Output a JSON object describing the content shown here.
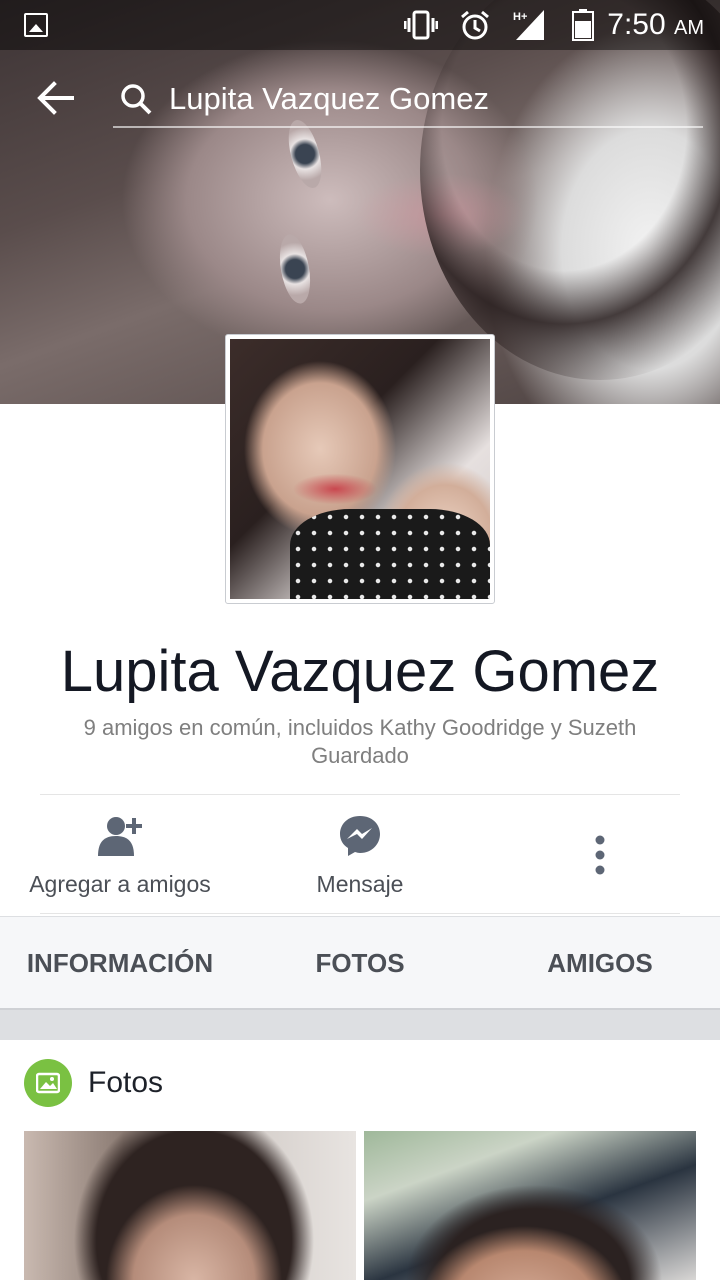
{
  "status_bar": {
    "time": "7:50",
    "ampm": "AM",
    "icons": [
      "gallery-icon",
      "vibrate-icon",
      "alarm-icon",
      "signal-hplus-icon",
      "battery-icon"
    ],
    "network_label": "H+"
  },
  "search": {
    "query": "Lupita Vazquez Gomez"
  },
  "profile": {
    "name": "Lupita Vazquez Gomez",
    "mutual_friends": "9 amigos en común, incluidos Kathy Goodridge y Suzeth Guardado"
  },
  "actions": {
    "add_friend": "Agregar a amigos",
    "message": "Mensaje"
  },
  "tabs": [
    {
      "label": "INFORMACIÓN"
    },
    {
      "label": "FOTOS"
    },
    {
      "label": "AMIGOS"
    }
  ],
  "photos_section": {
    "title": "Fotos"
  },
  "colors": {
    "photos_badge": "#7ac142",
    "tab_text": "#4b4f56",
    "action_icon": "#5d6675"
  }
}
